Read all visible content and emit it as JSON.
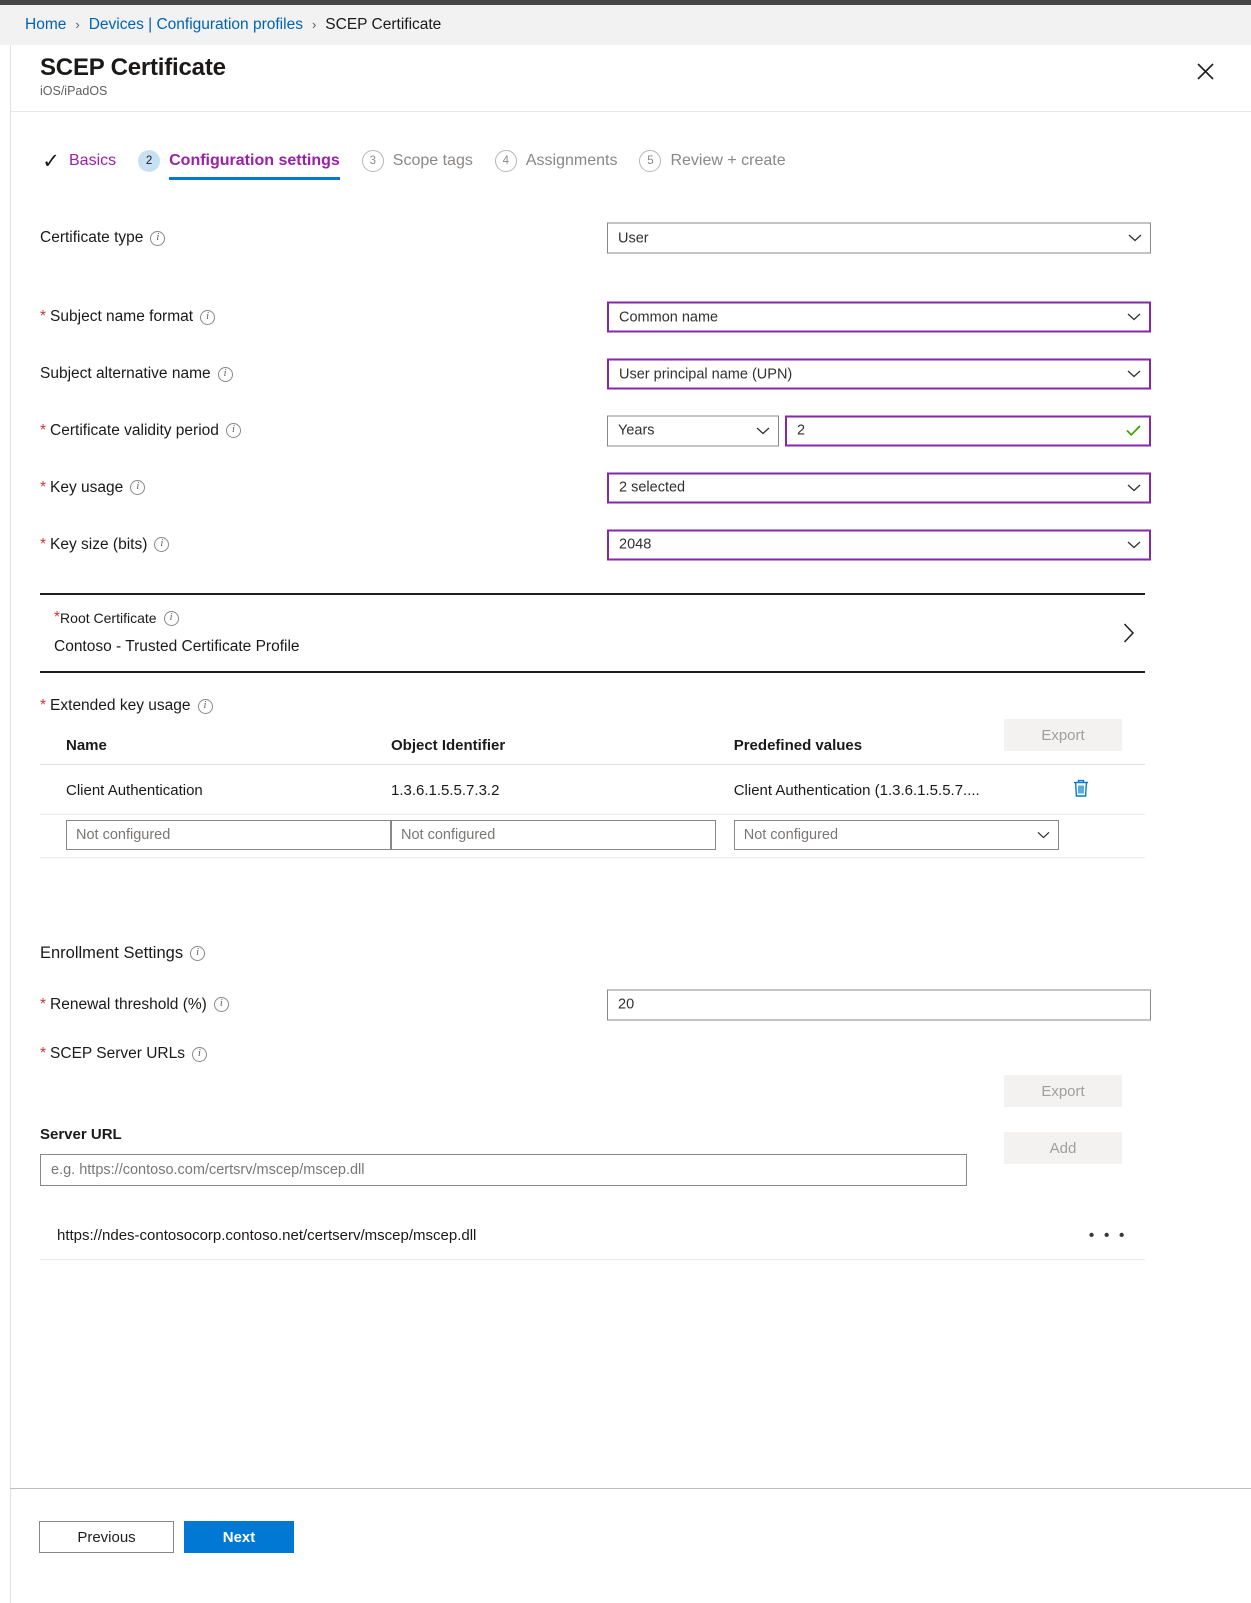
{
  "breadcrumb": {
    "items": [
      {
        "label": "Home",
        "link": true
      },
      {
        "label": "Devices | Configuration profiles",
        "link": true
      },
      {
        "label": "SCEP Certificate",
        "link": false
      }
    ],
    "separator": "›"
  },
  "blade": {
    "title": "SCEP Certificate",
    "subtitle": "iOS/iPadOS",
    "close_icon": "close-icon"
  },
  "wizard": {
    "steps": [
      {
        "marker": "✓",
        "label": "Basics",
        "state": "done"
      },
      {
        "marker": "2",
        "label": "Configuration settings",
        "state": "current"
      },
      {
        "marker": "3",
        "label": "Scope tags",
        "state": "todo"
      },
      {
        "marker": "4",
        "label": "Assignments",
        "state": "todo"
      },
      {
        "marker": "5",
        "label": "Review + create",
        "state": "todo"
      }
    ]
  },
  "fields": {
    "certificate_type": {
      "label": "Certificate type",
      "value": "User",
      "required": false
    },
    "subject_name_format": {
      "label": "Subject name format",
      "value": "Common name",
      "required": true
    },
    "subject_alternative_name": {
      "label": "Subject alternative name",
      "value": "User principal name (UPN)",
      "required": false
    },
    "certificate_validity_period": {
      "label": "Certificate validity period",
      "unit_value": "Years",
      "amount_value": "2",
      "required": true
    },
    "key_usage": {
      "label": "Key usage",
      "value": "2 selected",
      "required": true
    },
    "key_size": {
      "label": "Key size (bits)",
      "value": "2048",
      "required": true
    }
  },
  "root_certificate": {
    "label": "Root Certificate",
    "value": "Contoso - Trusted Certificate Profile",
    "required": true
  },
  "extended_key_usage": {
    "label": "Extended key usage",
    "required": true,
    "export_label": "Export",
    "columns": [
      "Name",
      "Object Identifier",
      "Predefined values"
    ],
    "rows": [
      {
        "name": "Client Authentication",
        "oid": "1.3.6.1.5.5.7.3.2",
        "predefined": "Client Authentication (1.3.6.1.5.5.7....",
        "delete_icon": "trash-icon"
      }
    ],
    "new_row": {
      "name_placeholder": "Not configured",
      "oid_placeholder": "Not configured",
      "predefined_placeholder": "Not configured"
    }
  },
  "enrollment": {
    "heading": "Enrollment Settings",
    "renewal_threshold": {
      "label": "Renewal threshold (%)",
      "value": "20",
      "required": true
    },
    "scep_server_urls": {
      "label": "SCEP Server URLs",
      "required": true,
      "export_label": "Export",
      "add_label": "Add",
      "server_url_label": "Server URL",
      "server_url_placeholder": "e.g. https://contoso.com/certsrv/mscep/mscep.dll",
      "server_url_value": "",
      "entries": [
        {
          "url": "https://ndes-contosocorp.contoso.net/certserv/mscep/mscep.dll",
          "menu": "• • •"
        }
      ]
    }
  },
  "footer": {
    "previous_label": "Previous",
    "next_label": "Next"
  },
  "colors": {
    "link": "#0063b1",
    "primary": "#0078d4",
    "wizard_visited": "#9b1fa8",
    "required_asterisk": "#d13438",
    "field_focus_border": "#8527a6",
    "validation_ok": "#3aa302",
    "topbar": "#464646",
    "breadcrumb_bg": "#f2f2f2"
  }
}
